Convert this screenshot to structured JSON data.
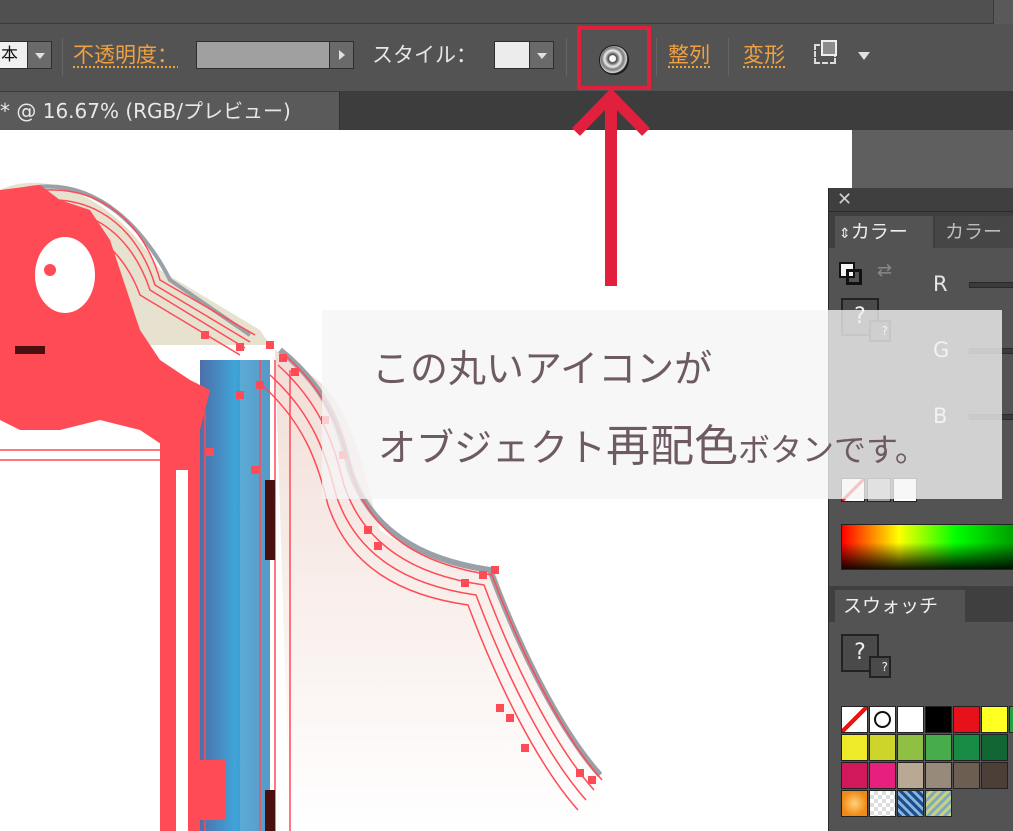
{
  "toolbar": {
    "partial_field": "本",
    "opacity_label": "不透明度：",
    "style_label": "スタイル：",
    "align_label": "整列",
    "transform_label": "変形"
  },
  "document_tab": {
    "title": "* @ 16.67% (RGB/プレビュー)"
  },
  "color_panel": {
    "tab_active": "カラー",
    "tab_inactive": "カラー",
    "channels": [
      "R",
      "G",
      "B"
    ],
    "question": "?",
    "mini_question": "?"
  },
  "swatches_panel": {
    "tab_active": "スウォッチ",
    "question": "?",
    "colors": [
      "#ffffff",
      "#000000",
      "#e8111b",
      "#ffff22",
      "#22a63b",
      "#eeea2a",
      "#cdd42a",
      "#8fc043",
      "#47ad4a",
      "#178a44",
      "#116633",
      "#d0185a",
      "#e6207c",
      "#b9a894",
      "#988a7b",
      "#6d5e52",
      "#4b3f38"
    ]
  },
  "annotation": {
    "line1": "この丸いアイコンが",
    "line2_a": "オブジェクト",
    "line2_b": "再配色",
    "line2_c": "ボタンです。",
    "highlight_color": "#e0203c"
  },
  "icons": {
    "recolor": "recolor-artwork-icon",
    "transform": "transform-icon",
    "swap": "swap-arrows-icon",
    "close": "close-icon"
  }
}
